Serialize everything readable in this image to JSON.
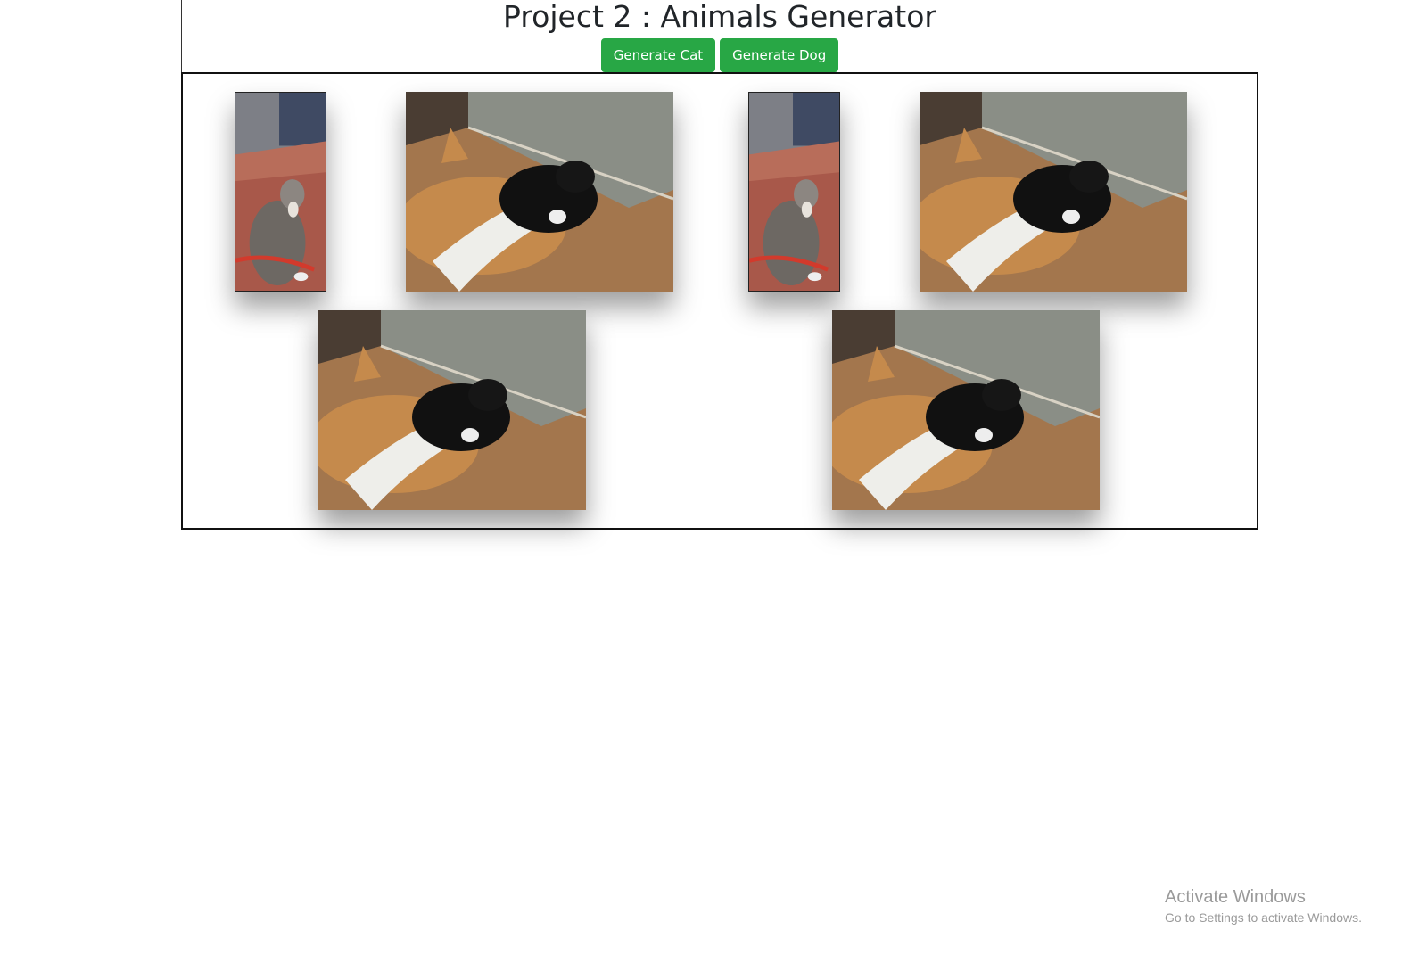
{
  "header": {
    "title": "Project 2 : Animals Generator",
    "buttons": {
      "cat_label": "Generate Cat",
      "dog_label": "Generate Dog"
    }
  },
  "gallery": {
    "images": [
      {
        "subject": "cat-standing-photo"
      },
      {
        "subject": "corgi-and-black-cat-photo"
      },
      {
        "subject": "cat-standing-photo"
      },
      {
        "subject": "corgi-and-black-cat-photo"
      },
      {
        "subject": "corgi-and-black-cat-photo"
      },
      {
        "subject": "corgi-and-black-cat-photo"
      }
    ]
  },
  "watermark": {
    "title": "Activate Windows",
    "subtitle": "Go to Settings to activate Windows."
  },
  "colors": {
    "button_green": "#28a745",
    "title_text": "#212529"
  }
}
